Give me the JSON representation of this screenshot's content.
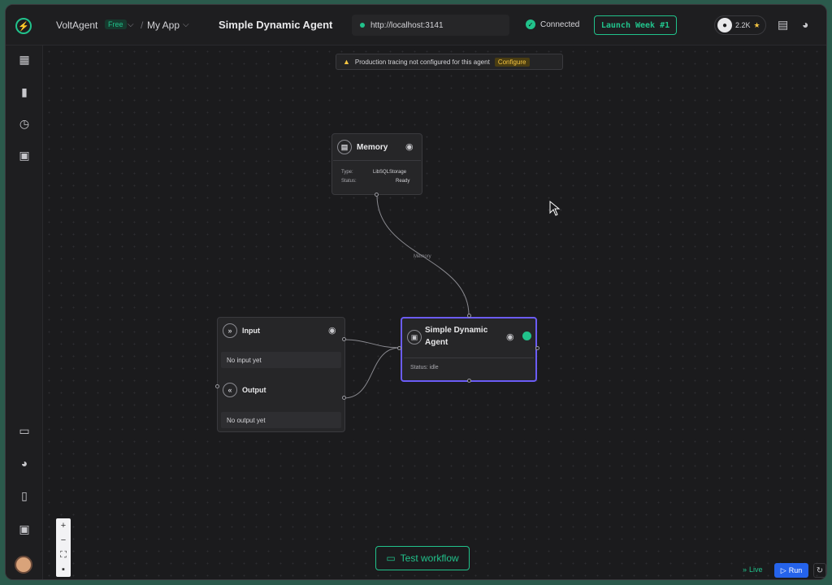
{
  "header": {
    "brand": "VoltAgent",
    "plan_badge": "Free",
    "breadcrumb_separator": "/",
    "app_name": "My App",
    "agent_title": "Simple Dynamic Agent",
    "server_url": "http://localhost:3141",
    "connection_status": "Connected",
    "launch_label": "Launch Week #1",
    "github_stars": "2.2K"
  },
  "banner": {
    "text": "Production tracing not configured for this agent",
    "action_label": "Configure"
  },
  "nodes": {
    "memory": {
      "title": "Memory",
      "type_label": "Type:",
      "type_value": "LibSQLStorage",
      "status_label": "Status:",
      "status_value": "Ready"
    },
    "io": {
      "input_title": "Input",
      "input_value": "No input yet",
      "output_title": "Output",
      "output_value": "No output yet"
    },
    "agent": {
      "title_line1": "Simple Dynamic",
      "title_line2": "Agent",
      "status": "Status: idle"
    }
  },
  "edges": {
    "memory_label": "Memory"
  },
  "footer": {
    "test_workflow_label": "Test workflow",
    "live_label": "Live",
    "run_label": "Run"
  },
  "colors": {
    "accent": "#21c28b",
    "agent_border": "#6b5cf6",
    "run_button": "#2563eb",
    "warning": "#f5c542"
  }
}
